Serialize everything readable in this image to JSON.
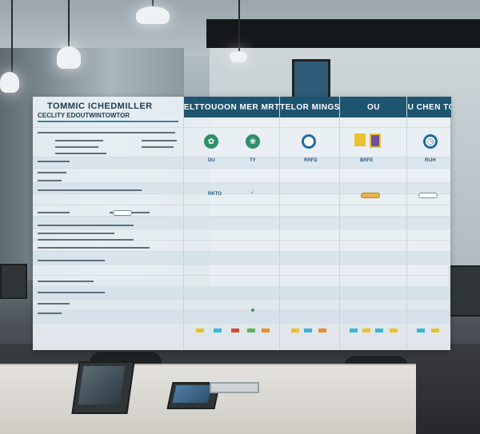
{
  "board": {
    "left_title_line1": "TOMMIC ICHEDMILLER",
    "left_title_line2": "CECLITY EDOUTWINTOWTOR",
    "columns": [
      {
        "header": "FELTTOUOON MER MRTY",
        "cells": [
          "DU",
          "TY"
        ],
        "mid_label": "RKTO"
      },
      {
        "header": "TELOR MINGS",
        "cells": [
          "RRFD"
        ],
        "mid_label": ""
      },
      {
        "header": "OU",
        "cells": [
          "BRFE"
        ],
        "mid_label": ""
      },
      {
        "header": "OU OU CHEN TORES",
        "cells": [
          "RIJH"
        ],
        "mid_label": ""
      }
    ]
  },
  "colors": {
    "header_blue": "#1d5470",
    "icon_green": "#2f8f6d",
    "icon_blue": "#1f6da0",
    "swatch_yellow": "#e9c22c",
    "swatch_cyan": "#38b6d8",
    "swatch_red": "#d64b36",
    "swatch_green": "#5bb45a",
    "swatch_orange": "#ea8b2c"
  }
}
